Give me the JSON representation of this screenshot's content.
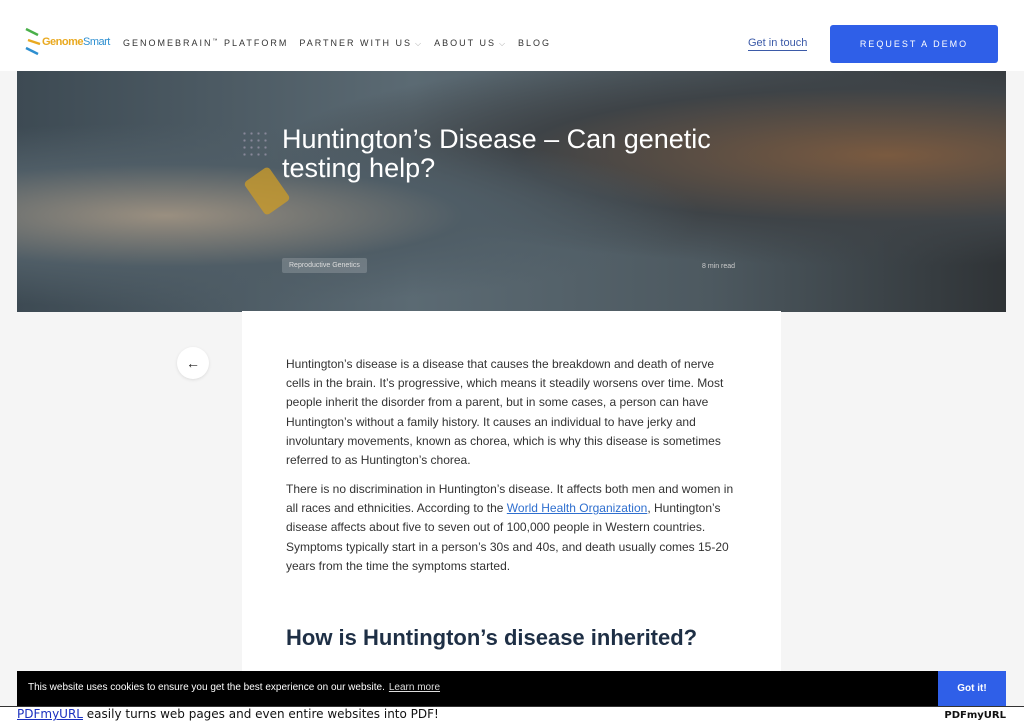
{
  "header": {
    "logo": {
      "part1": "Genome",
      "part2": "Smart"
    },
    "nav": [
      {
        "label": "GENOMEBRAIN",
        "sup": "™",
        "label2": " PLATFORM",
        "dropdown": false
      },
      {
        "label": "PARTNER WITH US",
        "dropdown": true
      },
      {
        "label": "ABOUT US",
        "dropdown": true
      },
      {
        "label": "BLOG",
        "dropdown": false
      }
    ],
    "contact": "Get in touch",
    "demo": "REQUEST A DEMO"
  },
  "hero": {
    "title": "Huntington’s Disease – Can genetic testing help?",
    "tag": "Reproductive Genetics",
    "read_time": "8 min read"
  },
  "article": {
    "back_icon": "arrow-left-icon",
    "p1": "Huntington’s disease is a disease that causes the breakdown and death of nerve cells in the brain. It’s progressive, which means it steadily worsens over time. Most people inherit the disorder from a parent, but in some cases, a person can have Huntington’s without a family history. It causes an individual to have jerky and involuntary movements, known as chorea, which is why this disease is sometimes referred to as Huntington’s chorea.",
    "p2_before": "There is no discrimination in Huntington’s disease. It affects both men and women in all races and ethnicities. According to the ",
    "p2_link": "World Health Organization",
    "p2_after": ", Huntington’s disease affects about five to seven out of 100,000 people in Western countries. Symptoms typically start in a person’s 30s and 40s, and death usually comes 15-20 years from the time the symptoms started.",
    "h2": "How is Huntington’s disease inherited?"
  },
  "cookie": {
    "message": "This website uses cookies to ensure you get the best experience on our website.",
    "learn_more": "Learn more",
    "accept": "Got it!"
  },
  "footer": {
    "link": "PDFmyURL",
    "text": " easily turns web pages and even entire websites into PDF!",
    "brand": "PDFmyURL"
  },
  "colors": {
    "accent": "#2f5fe8",
    "heading": "#1e2f45"
  }
}
